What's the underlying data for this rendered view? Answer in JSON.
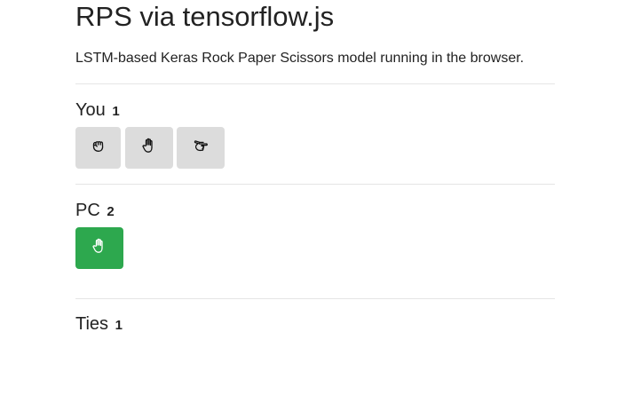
{
  "header": {
    "title": "RPS via tensorflow.js",
    "description": "LSTM-based Keras Rock Paper Scissors model running in the browser."
  },
  "you": {
    "label": "You",
    "score": "1",
    "buttons": [
      {
        "name": "rock",
        "icon": "hand-rock-icon"
      },
      {
        "name": "paper",
        "icon": "hand-paper-icon"
      },
      {
        "name": "scissors",
        "icon": "hand-scissors-icon"
      }
    ]
  },
  "pc": {
    "label": "PC",
    "score": "2",
    "choice": {
      "name": "paper",
      "icon": "hand-paper-icon"
    }
  },
  "ties": {
    "label": "Ties",
    "score": "1"
  },
  "colors": {
    "button_gray": "#dcdcdc",
    "pc_choice_green": "#2da84e"
  }
}
